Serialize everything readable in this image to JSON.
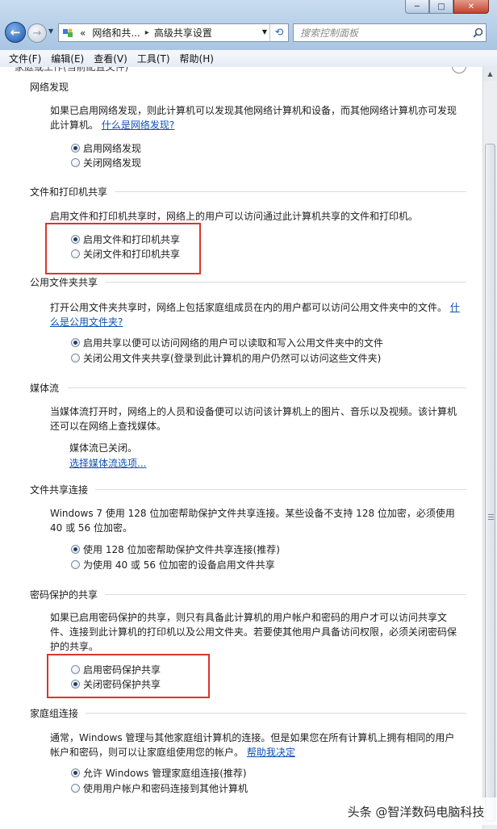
{
  "window": {
    "caption_buttons": {
      "minimize": "─",
      "maximize": "□",
      "close": "✕"
    }
  },
  "nav": {
    "back_glyph": "←",
    "forward_glyph": "→",
    "dropdown_glyph": "▼",
    "address": {
      "overflow": "«",
      "crumbs": [
        "网络和共...",
        "高级共享设置"
      ],
      "separator": "▸",
      "dropdown_glyph": "▼",
      "refresh_glyph": "⟲"
    },
    "search_placeholder": "搜索控制面板"
  },
  "menubar": {
    "items": [
      "文件(F)",
      "编辑(E)",
      "查看(V)",
      "工具(T)",
      "帮助(H)"
    ]
  },
  "top_partial_text": "家庭或工作(当前配置文件)",
  "collapse_glyph": "⌃",
  "sections": {
    "network_discovery": {
      "heading": "网络发现",
      "desc": "如果已启用网络发现，则此计算机可以发现其他网络计算机和设备，而其他网络计算机亦可发现此计算机。",
      "link": "什么是网络发现?",
      "options": [
        "启用网络发现",
        "关闭网络发现"
      ],
      "selected": 0
    },
    "file_printer_sharing": {
      "heading": "文件和打印机共享",
      "desc": "启用文件和打印机共享时，网络上的用户可以访问通过此计算机共享的文件和打印机。",
      "options": [
        "启用文件和打印机共享",
        "关闭文件和打印机共享"
      ],
      "selected": 0
    },
    "public_folder_sharing": {
      "heading": "公用文件夹共享",
      "desc": "打开公用文件夹共享时，网络上包括家庭组成员在内的用户都可以访问公用文件夹中的文件。",
      "link": "什么是公用文件夹?",
      "options": [
        "启用共享以便可以访问网络的用户可以读取和写入公用文件夹中的文件",
        "关闭公用文件夹共享(登录到此计算机的用户仍然可以访问这些文件夹)"
      ],
      "selected": 0
    },
    "media_streaming": {
      "heading": "媒体流",
      "desc": "当媒体流打开时，网络上的人员和设备便可以访问该计算机上的图片、音乐以及视频。该计算机还可以在网络上查找媒体。",
      "status": "媒体流已关闭。",
      "link": "选择媒体流选项..."
    },
    "file_sharing_connections": {
      "heading": "文件共享连接",
      "desc": "Windows 7 使用 128 位加密帮助保护文件共享连接。某些设备不支持 128 位加密，必须使用 40 或 56 位加密。",
      "options": [
        "使用 128 位加密帮助保护文件共享连接(推荐)",
        "为使用 40 或 56 位加密的设备启用文件共享"
      ],
      "selected": 0
    },
    "password_protected_sharing": {
      "heading": "密码保护的共享",
      "desc": "如果已启用密码保护的共享，则只有具备此计算机的用户帐户和密码的用户才可以访问共享文件、连接到此计算机的打印机以及公用文件夹。若要使其他用户具备访问权限，必须关闭密码保护的共享。",
      "options": [
        "启用密码保护共享",
        "关闭密码保护共享"
      ],
      "selected": 1
    },
    "homegroup_connections": {
      "heading": "家庭组连接",
      "desc": "通常，Windows 管理与其他家庭组计算机的连接。但是如果您在所有计算机上拥有相同的用户帐户和密码，则可以让家庭组使用您的帐户。",
      "link": "帮助我决定",
      "options": [
        "允许 Windows 管理家庭组连接(推荐)",
        "使用用户帐户和密码连接到其他计算机"
      ],
      "selected": 0
    }
  },
  "scroll_position": 0.06,
  "highlight_color": "#d9362d",
  "link_color": "#0f51b5",
  "watermark": "头条 @智洋数码电脑科技"
}
